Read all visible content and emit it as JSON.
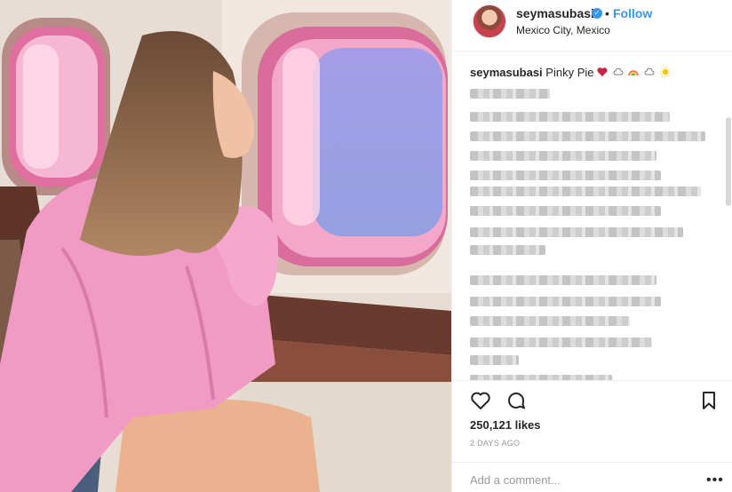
{
  "post": {
    "image_alt": "Woman in pink denim jacket looking out of an airplane window"
  },
  "header": {
    "username": "seymasubasi",
    "verified_glyph": "✓",
    "separator": "•",
    "follow_label": "Follow",
    "location": "Mexico City, Mexico"
  },
  "caption": {
    "username": "seymasubasi",
    "text": "Pinky Pie",
    "emojis": [
      "heart-icon",
      "cloud-icon",
      "rainbow-icon",
      "cloud-icon",
      "sun-icon"
    ]
  },
  "comments_area": {
    "blurred": true
  },
  "actions": {
    "icons": [
      "heart-icon",
      "comment-icon",
      "bookmark-icon"
    ]
  },
  "likes": "250,121 likes",
  "time_ago": "2 DAYS AGO",
  "comment_box": {
    "placeholder": "Add a comment...",
    "more_glyph": "•••"
  },
  "colors": {
    "accent": "#3897f0",
    "jacket": "#f19ac3",
    "window_pink": "#ea8fb8"
  }
}
